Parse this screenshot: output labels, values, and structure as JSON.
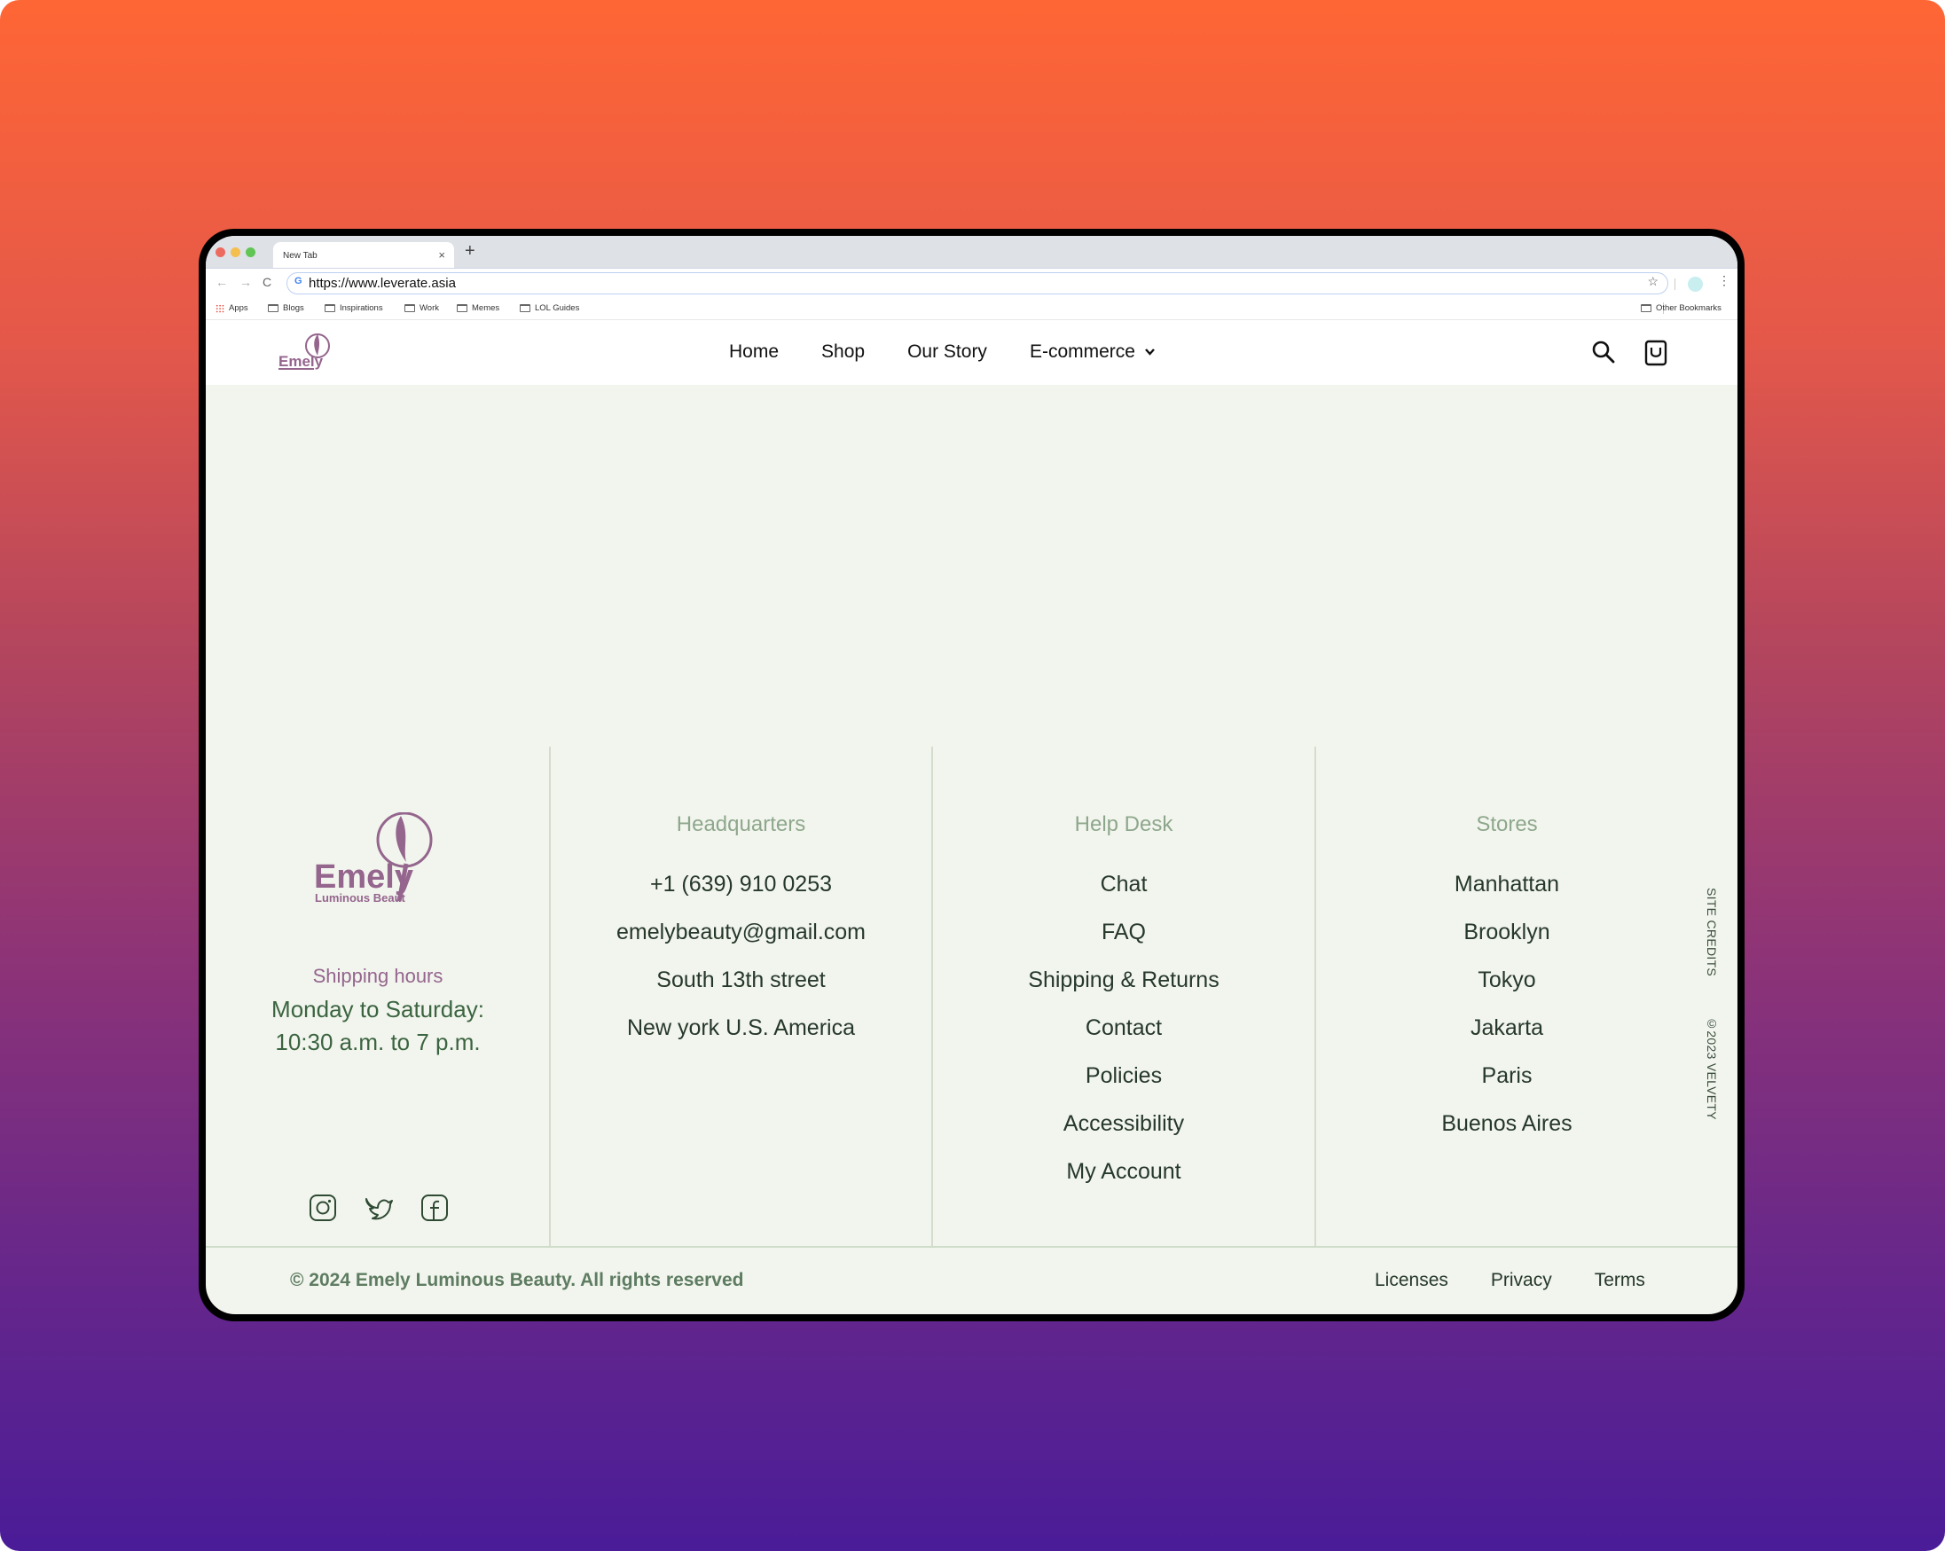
{
  "browser": {
    "tab_title": "New Tab",
    "tab_close": "×",
    "new_tab": "+",
    "url": "https://www.leverate.asia",
    "back": "←",
    "forward": "→",
    "reload": "C",
    "star": "☆",
    "menu": "⋮",
    "bookmarks": [
      "Apps",
      "Blogs",
      "Inspirations",
      "Work",
      "Memes",
      "LOL Guides"
    ],
    "other_bookmarks": "Other Bookmarks"
  },
  "header": {
    "logo_text": "Emely",
    "nav": [
      "Home",
      "Shop",
      "Our Story",
      "E-commerce"
    ],
    "dropdown_icon": "chevron-down-icon",
    "icons": [
      "search-icon",
      "shopping-bag-icon"
    ]
  },
  "footer": {
    "brand": {
      "name": "Emely",
      "tagline": "Luminous Beaut",
      "shipping_label": "Shipping hours",
      "shipping_days": "Monday to Saturday:",
      "shipping_time": "10:30 a.m. to 7 p.m.",
      "socials": [
        "instagram-icon",
        "twitter-icon",
        "facebook-icon"
      ]
    },
    "headquarters": {
      "title": "Headquarters",
      "items": [
        "+1 (639) 910 0253",
        "emelybeauty@gmail.com",
        "South 13th street",
        "New york U.S. America"
      ]
    },
    "help_desk": {
      "title": "Help Desk",
      "items": [
        "Chat",
        "FAQ",
        "Shipping & Returns",
        "Contact",
        "Policies",
        "Accessibility",
        "My Account"
      ]
    },
    "stores": {
      "title": "Stores",
      "items": [
        "Manhattan",
        "Brooklyn",
        "Tokyo",
        "Jakarta",
        "Paris",
        "Buenos Aires"
      ]
    },
    "side_credits": "SITE CREDITS",
    "side_copyright": "©2023 VELVETY",
    "copyright": "© 2024 Emely Luminous Beauty. All rights reserved",
    "legal": [
      "Licenses",
      "Privacy",
      "Terms"
    ]
  },
  "colors": {
    "brand_purple": "#94658d",
    "text_green_dark": "#26382a",
    "heading_green": "#8ea78c",
    "page_bg": "#f2f5ee"
  }
}
